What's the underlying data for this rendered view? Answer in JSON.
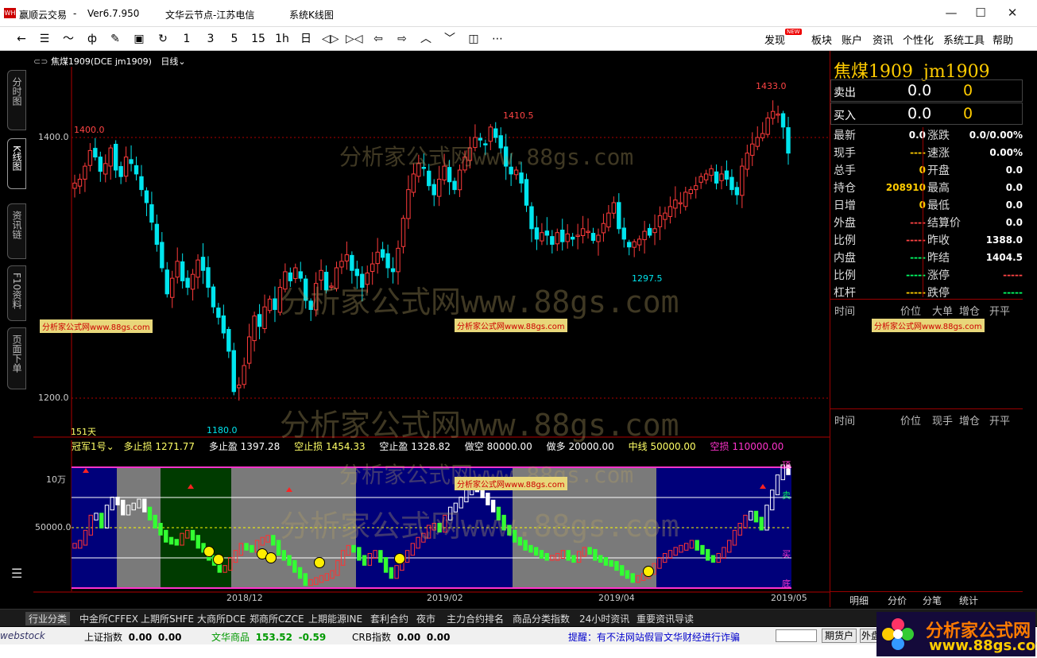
{
  "window": {
    "app_name": "赢顺云交易",
    "version": "Ver6.7.950",
    "node": "文华云节点-江苏电信",
    "view_title": "系统K线图"
  },
  "toolbar": {
    "periods": [
      "1",
      "3",
      "5",
      "15",
      "1h",
      "日"
    ],
    "menu": [
      "发现",
      "板块",
      "账户",
      "资讯",
      "个性化",
      "系统工具",
      "帮助"
    ],
    "new_badge": "NEW"
  },
  "sidetabs": [
    "分时图",
    "K线图",
    "资讯链",
    "F10资料",
    "页面下单"
  ],
  "chart": {
    "header": {
      "symbol_line": "焦煤1909(DCE jm1909)",
      "period": "日线"
    },
    "y_labels": [
      "1400.0",
      "1200.0"
    ],
    "x_labels": [
      "2018/12",
      "2019/02",
      "2019/04",
      "2019/05"
    ],
    "annotations": {
      "days": "151天",
      "high1": "1400.0",
      "high2": "1410.5",
      "high3": "1433.0",
      "low1": "1180.0",
      "low2": "1297.5"
    },
    "colors": {
      "up": "#ff3b3b",
      "down": "#00e5ee",
      "bg": "#000000",
      "grid": "#b00000"
    }
  },
  "indicator": {
    "name": "冠军1号",
    "params": [
      {
        "label": "多止损",
        "value": "1271.77",
        "color": "#ffff66"
      },
      {
        "label": "多止盈",
        "value": "1397.28",
        "color": "#ffffff"
      },
      {
        "label": "空止损",
        "value": "1454.33",
        "color": "#ffff66"
      },
      {
        "label": "空止盈",
        "value": "1328.82",
        "color": "#ffffff"
      },
      {
        "label": "做空",
        "value": "80000.00",
        "color": "#ffffff"
      },
      {
        "label": "做多",
        "value": "20000.00",
        "color": "#ffffff"
      },
      {
        "label": "中线",
        "value": "50000.00",
        "color": "#ffff66"
      },
      {
        "label": "空损",
        "value": "110000.00",
        "color": "#ff33cc"
      }
    ],
    "y_labels": [
      "10万",
      "50000.0"
    ],
    "right_labels": [
      "顶",
      "卖",
      "买",
      "底"
    ]
  },
  "quote": {
    "name": "焦煤1909",
    "code": "jm1909",
    "sell": {
      "label": "卖出",
      "price": "0.0",
      "vol": "0"
    },
    "buy": {
      "label": "买入",
      "price": "0.0",
      "vol": "0"
    },
    "rows": [
      {
        "l": "最新",
        "lv": "0.0",
        "r": "涨跌",
        "rv": "0.0/0.00%",
        "lc": "#ffffff",
        "rc": "#ffffff"
      },
      {
        "l": "现手",
        "lv": "----",
        "r": "速涨",
        "rv": "0.00%",
        "lc": "#ffcc00",
        "rc": "#ffffff"
      },
      {
        "l": "总手",
        "lv": "0",
        "r": "开盘",
        "rv": "0.0",
        "lc": "#ffcc00",
        "rc": "#ffffff"
      },
      {
        "l": "持仓",
        "lv": "208910",
        "r": "最高",
        "rv": "0.0",
        "lc": "#ffcc00",
        "rc": "#ffffff"
      },
      {
        "l": "日增",
        "lv": "0",
        "r": "最低",
        "rv": "0.0",
        "lc": "#ffcc00",
        "rc": "#ffffff"
      },
      {
        "l": "外盘",
        "lv": "----",
        "r": "结算价",
        "rv": "0.0",
        "lc": "#ff4444",
        "rc": "#ffffff"
      },
      {
        "l": "比例",
        "lv": "-----",
        "r": "昨收",
        "rv": "1388.0",
        "lc": "#ff4444",
        "rc": "#ffffff"
      },
      {
        "l": "内盘",
        "lv": "----",
        "r": "昨结",
        "rv": "1404.5",
        "lc": "#00ff66",
        "rc": "#ffffff"
      },
      {
        "l": "比例",
        "lv": "-----",
        "r": "涨停",
        "rv": "-----",
        "lc": "#00ff66",
        "rc": "#ff4444"
      },
      {
        "l": "杠杆",
        "lv": "-----",
        "r": "跌停",
        "rv": "-----",
        "lc": "#ffcc00",
        "rc": "#00ff66"
      }
    ],
    "ticks_header": [
      "时间",
      "价位",
      "大单",
      "增仓",
      "开平"
    ],
    "trades_header": [
      "时间",
      "价位",
      "现手",
      "增仓",
      "开平"
    ],
    "panel_tabs": [
      "明细",
      "分价",
      "分笔",
      "统计"
    ]
  },
  "bottom_tabs": [
    "行业分类",
    "中金所CFFEX",
    "上期所SHFE",
    "大商所DCE",
    "郑商所CZCE",
    "上期能源INE",
    "套利合约",
    "夜市",
    "主力合约排名",
    "商品分类指数",
    "24小时资讯",
    "重要资讯导读"
  ],
  "status": {
    "idx1": {
      "label": "上证指数",
      "v1": "0.00",
      "v2": "0.00"
    },
    "idx2": {
      "label": "文华商品",
      "v1": "153.52",
      "v2": "-0.59"
    },
    "idx3": {
      "label": "CRB指数",
      "v1": "0.00",
      "v2": "0.00"
    },
    "notice": "提醒：有不法网站假冒文华财经进行诈骗",
    "btn1": "期货户",
    "btn2": "外盘"
  },
  "watermarks": {
    "big": "分析家公式网www.88gs.com",
    "small": "分析家公式网www.88gs.com",
    "brand": "分析家公式网",
    "brand_url": "www.88gs.com",
    "status_left": "webstock"
  },
  "series": {
    "price": [
      1365,
      1368,
      1378,
      1390,
      1385,
      1374,
      1380,
      1392,
      1375,
      1370,
      1385,
      1380,
      1372,
      1360,
      1350,
      1335,
      1318,
      1300,
      1280,
      1292,
      1305,
      1290,
      1285,
      1295,
      1306,
      1298,
      1285,
      1270,
      1262,
      1250,
      1236,
      1205,
      1210,
      1225,
      1247,
      1263,
      1255,
      1270,
      1276,
      1268,
      1285,
      1297,
      1290,
      1300,
      1292,
      1275,
      1268,
      1288,
      1298,
      1283,
      1286,
      1300,
      1305,
      1310,
      1298,
      1294,
      1285,
      1296,
      1303,
      1312,
      1308,
      1300,
      1297,
      1315,
      1338,
      1360,
      1372,
      1380,
      1377,
      1363,
      1356,
      1368,
      1378,
      1366,
      1360,
      1375,
      1385,
      1392,
      1400,
      1398,
      1395,
      1408,
      1400,
      1392,
      1378,
      1372,
      1375,
      1365,
      1348,
      1330,
      1322,
      1327,
      1325,
      1318,
      1327,
      1320,
      1326,
      1322,
      1325,
      1330,
      1328,
      1321,
      1325,
      1334,
      1342,
      1350,
      1330,
      1322,
      1316,
      1320,
      1322,
      1328,
      1325,
      1330,
      1340,
      1342,
      1347,
      1352,
      1350,
      1358,
      1360,
      1363,
      1370,
      1372,
      1376,
      1365,
      1372,
      1368,
      1360,
      1356,
      1378,
      1388,
      1395,
      1400,
      1403,
      1415,
      1420,
      1418,
      1408,
      1388
    ],
    "ind": [
      42,
      45,
      55,
      70,
      72,
      62,
      80,
      88,
      85,
      75,
      80,
      82,
      86,
      78,
      70,
      62,
      55,
      48,
      46,
      45,
      52,
      55,
      50,
      42,
      38,
      30,
      25,
      18,
      20,
      28,
      35,
      42,
      40,
      38,
      45,
      48,
      50,
      45,
      35,
      30,
      25,
      18,
      12,
      5,
      6,
      8,
      10,
      12,
      15,
      25,
      35,
      40,
      38,
      30,
      25,
      32,
      35,
      28,
      18,
      12,
      20,
      28,
      35,
      42,
      48,
      52,
      60,
      62,
      58,
      70,
      78,
      82,
      88,
      95,
      100,
      98,
      92,
      85,
      78,
      70,
      60,
      55,
      48,
      45,
      40,
      38,
      35,
      32,
      30,
      30,
      32,
      35,
      30,
      28,
      34,
      38,
      36,
      30,
      28,
      25,
      24,
      20,
      15,
      12,
      8,
      10,
      12,
      16,
      22,
      28,
      32,
      35,
      38,
      40,
      42,
      45,
      40,
      36,
      30,
      28,
      32,
      38,
      45,
      55,
      62,
      70,
      74,
      68,
      60,
      80,
      95,
      110,
      120,
      115
    ]
  }
}
